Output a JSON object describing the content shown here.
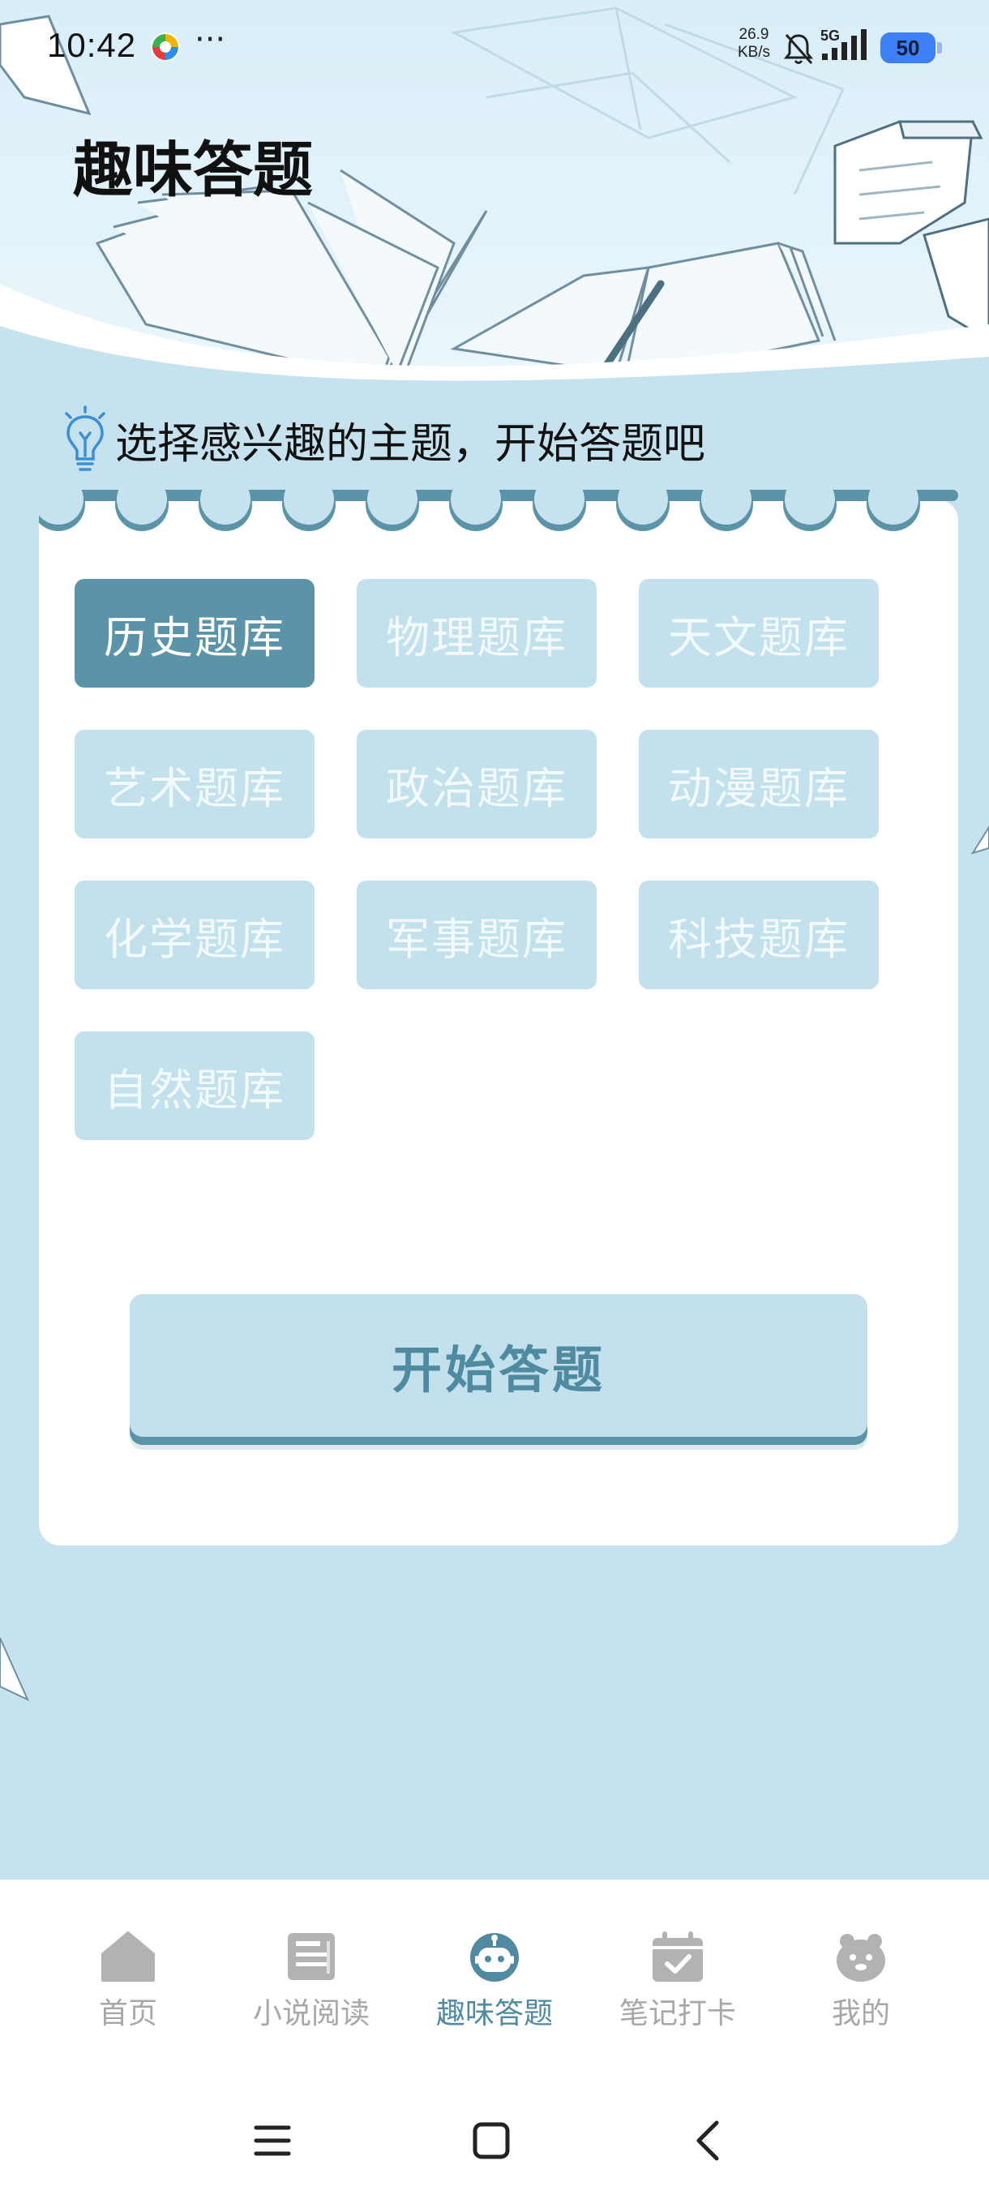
{
  "status_bar": {
    "time": "10:42",
    "more": "···",
    "net_speed_value": "26.9",
    "net_speed_unit": "KB/s",
    "network": "5G",
    "battery": "50"
  },
  "header": {
    "title": "趣味答题"
  },
  "prompt": {
    "text": "选择感兴趣的主题，开始答题吧"
  },
  "question_banks": [
    {
      "label": "历史题库",
      "selected": true
    },
    {
      "label": "物理题库",
      "selected": false
    },
    {
      "label": "天文题库",
      "selected": false
    },
    {
      "label": "艺术题库",
      "selected": false
    },
    {
      "label": "政治题库",
      "selected": false
    },
    {
      "label": "动漫题库",
      "selected": false
    },
    {
      "label": "化学题库",
      "selected": false
    },
    {
      "label": "军事题库",
      "selected": false
    },
    {
      "label": "科技题库",
      "selected": false
    },
    {
      "label": "自然题库",
      "selected": false
    }
  ],
  "start_button": {
    "label": "开始答题"
  },
  "tabbar": {
    "items": [
      {
        "label": "首页",
        "icon": "home-icon",
        "active": false
      },
      {
        "label": "小说阅读",
        "icon": "book-icon",
        "active": false
      },
      {
        "label": "趣味答题",
        "icon": "robot-icon",
        "active": true
      },
      {
        "label": "笔记打卡",
        "icon": "calendar-check-icon",
        "active": false
      },
      {
        "label": "我的",
        "icon": "profile-icon",
        "active": false
      }
    ]
  },
  "colors": {
    "page_background": "#c5e2ee",
    "accent": "#5b93a9",
    "chip_inactive": "#c3e1ec",
    "tab_active": "#4f8aa1",
    "tab_inactive": "#a7a7a7"
  }
}
